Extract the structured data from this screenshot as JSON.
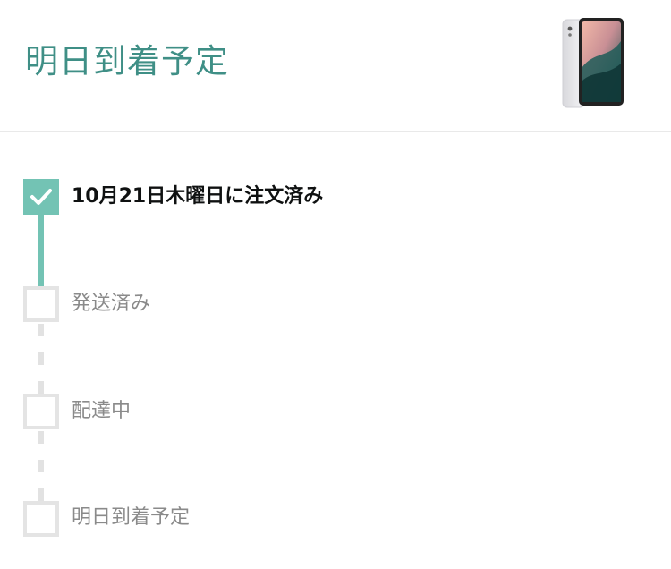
{
  "header": {
    "title": "明日到着予定",
    "product_image": "tablet-thumbnail"
  },
  "steps": [
    {
      "label": "10月21日木曜日に注文済み",
      "status": "completed",
      "icon": "check-icon"
    },
    {
      "label": "発送済み",
      "status": "pending"
    },
    {
      "label": "配達中",
      "status": "pending"
    },
    {
      "label": "明日到着予定",
      "status": "pending"
    }
  ],
  "colors": {
    "accent": "#73c3b4",
    "title": "#3f8f86",
    "pending_border": "#e4e4e4",
    "pending_text": "#8a8a8a",
    "completed_text": "#0f1111",
    "divider": "#e9e9e9"
  }
}
